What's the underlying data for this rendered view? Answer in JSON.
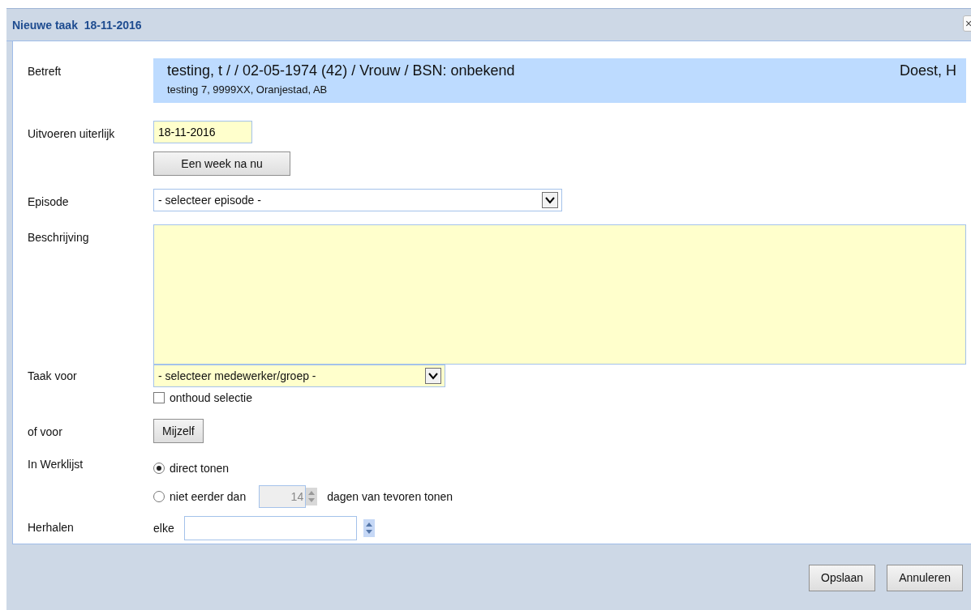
{
  "window": {
    "title": "Nieuwe taak  18-11-2016",
    "close": "×"
  },
  "form": {
    "subject": {
      "label": "Betreft",
      "patient": "testing, t / / 02-05-1974 (42) / Vrouw / BSN: onbekend",
      "address": "testing 7, 9999XX, Oranjestad, AB",
      "practitioner": "Doest, H"
    },
    "due": {
      "label": "Uitvoeren uiterlijk",
      "value": "18-11-2016",
      "button": "Een week na nu"
    },
    "episode": {
      "label": "Episode",
      "value": "- selecteer episode -"
    },
    "description": {
      "label": "Beschrijving"
    },
    "assignee": {
      "label": "Taak voor",
      "value": "- selecteer medewerker/groep -",
      "remember": {
        "label": "onthoud selectie",
        "checked": false
      }
    },
    "or_for": {
      "label": "of voor",
      "button": "Mijzelf"
    },
    "worklist": {
      "label": "In Werklijst",
      "options": [
        {
          "label": "direct tonen",
          "selected": true
        },
        {
          "label": "niet eerder dan",
          "selected": false,
          "days": "14",
          "suffix": "dagen van tevoren tonen"
        }
      ]
    },
    "repeat": {
      "label": "Herhalen",
      "prefix": "elke"
    }
  },
  "buttons": [
    "Opslaan",
    "Annuleren"
  ]
}
